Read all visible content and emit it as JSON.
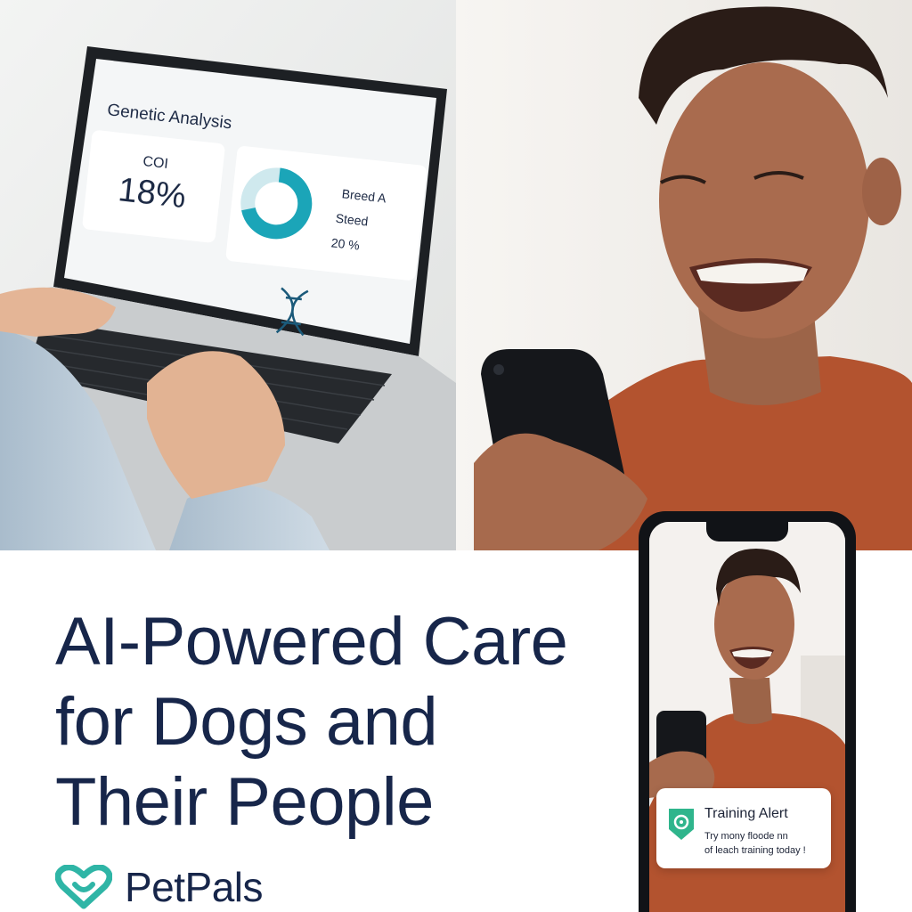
{
  "laptop_screen": {
    "title": "Genetic Analysis",
    "coi_label": "COI",
    "coi_value": "18%",
    "donut_fraction": 0.7,
    "breed_label": "Breed A",
    "breed_sublabel": "Steed",
    "breed_percent": "20 %",
    "dna_icon": "dna-icon"
  },
  "headline": {
    "line1": "AI-Powered Care",
    "line2": "for Dogs and",
    "line3": "Their People"
  },
  "brand": {
    "name": "PetPals",
    "logo_icon": "heart-logo-icon",
    "color": "#2fb5a6"
  },
  "notification": {
    "title": "Training Alert",
    "line1": "Try mony floode nn",
    "line2": "of leach training today !",
    "icon": "location-pin-shield-icon",
    "accent": "#2fb58c"
  },
  "colors": {
    "headline": "#17264a",
    "teal": "#1ba5b8",
    "sweater": "#b3532f"
  }
}
